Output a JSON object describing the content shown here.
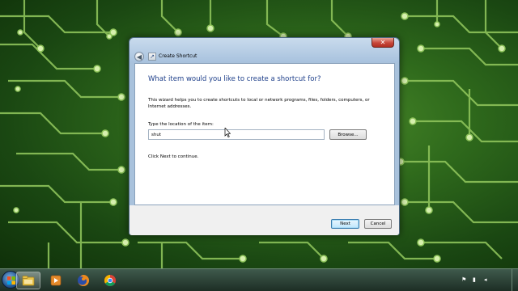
{
  "window": {
    "title": "Create Shortcut",
    "close_glyph": "✕",
    "back_glyph": "◀"
  },
  "wizard": {
    "heading": "What item would you like to create a shortcut for?",
    "description": "This wizard helps you to create shortcuts to local or network programs, files, folders, computers, or Internet addresses.",
    "location_label": "Type the location of the item:",
    "location_value": "shut",
    "browse_label": "Browse...",
    "continue_text": "Click Next to continue."
  },
  "footer": {
    "next_label": "Next",
    "cancel_label": "Cancel"
  },
  "taskbar": {
    "items": [
      {
        "name": "windows-explorer-icon",
        "active": true
      },
      {
        "name": "media-player-icon",
        "active": false
      },
      {
        "name": "firefox-icon",
        "active": false
      },
      {
        "name": "chrome-icon",
        "active": false
      }
    ]
  },
  "colors": {
    "heading": "#1e3f8a",
    "window_frame": "#a9c2dc",
    "close_button": "#c7473a",
    "wallpaper_trace": "#9ecf6a"
  }
}
